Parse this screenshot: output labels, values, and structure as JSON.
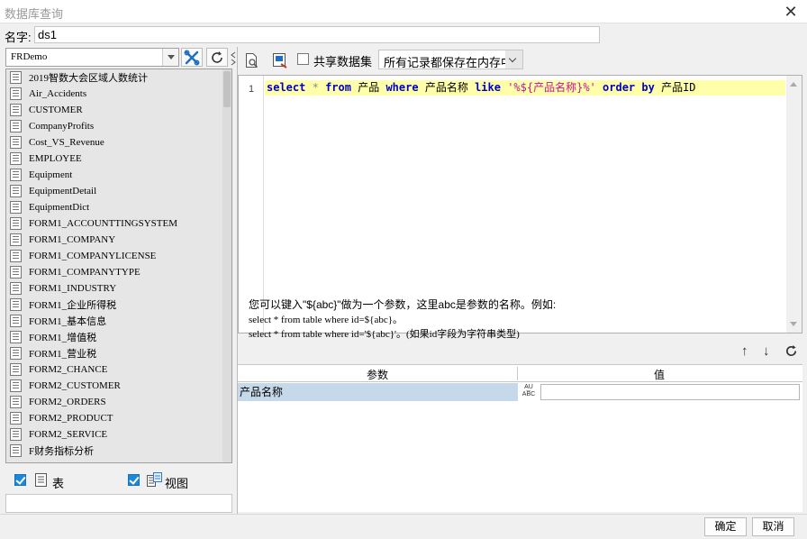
{
  "window": {
    "title": "数据库查询",
    "close_label": "✕"
  },
  "name_field": {
    "label": "名字:",
    "value": "ds1"
  },
  "connection": {
    "selected": "FRDemo"
  },
  "tables": [
    "2019智数大会区域人数统计",
    "Air_Accidents",
    "CUSTOMER",
    "CompanyProfits",
    "Cost_VS_Revenue",
    "EMPLOYEE",
    "Equipment",
    "EquipmentDetail",
    "EquipmentDict",
    "FORM1_ACCOUNTTINGSYSTEM",
    "FORM1_COMPANY",
    "FORM1_COMPANYLICENSE",
    "FORM1_COMPANYTYPE",
    "FORM1_INDUSTRY",
    "FORM1_企业所得税",
    "FORM1_基本信息",
    "FORM1_增值税",
    "FORM1_营业税",
    "FORM2_CHANCE",
    "FORM2_CUSTOMER",
    "FORM2_ORDERS",
    "FORM2_PRODUCT",
    "FORM2_SERVICE",
    "F财务指标分析"
  ],
  "filters": {
    "table_label": "表",
    "view_label": "视图"
  },
  "toolbar": {
    "share_label": "共享数据集",
    "memory_selected": "所有记录都保存在内存中"
  },
  "editor": {
    "line_number": "1",
    "tokens": {
      "t1": "select",
      "t2": "*",
      "t3": "from",
      "t4": "产品",
      "t5": "where",
      "t6": "产品名称",
      "t7": "like",
      "t8": "'%${产品名称}%'",
      "t9": "order",
      "t10": "by",
      "t11": "产品ID"
    }
  },
  "hint": {
    "line1": "您可以键入\"${abc}\"做为一个参数，这里abc是参数的名称。例如:",
    "line2": "select * from table where id=${abc}。",
    "line3": "select * from table where id='${abc}'。(如果id字段为字符串类型)"
  },
  "param_table": {
    "col_param": "参数",
    "col_value": "值",
    "rows": [
      {
        "name": "产品名称",
        "type_glyph_top": "A͜U",
        "type_glyph_bottom": "ABC",
        "value": ""
      }
    ]
  },
  "buttons": {
    "ok": "确定",
    "cancel": "取消"
  }
}
